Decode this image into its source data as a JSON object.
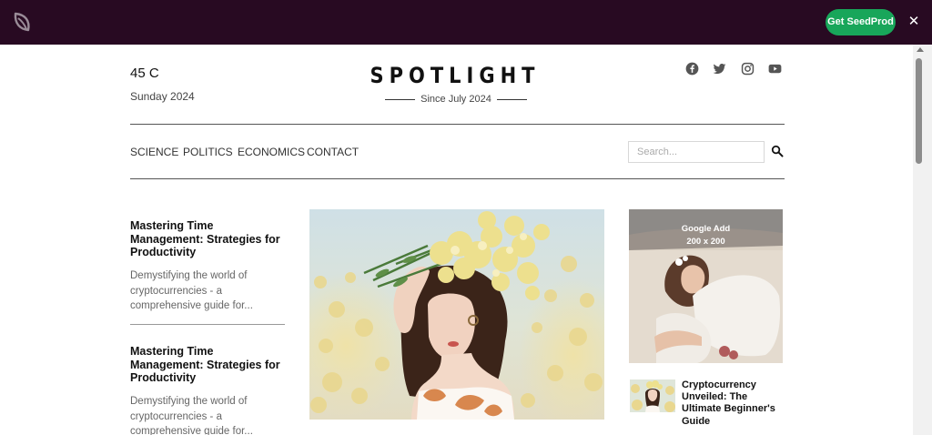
{
  "admin_bar": {
    "logo_icon": "seedprod-leaf-icon",
    "cta_label": "Get SeedProd",
    "close_label": "✕",
    "colors": {
      "background": "#280a22",
      "cta": "#18a65a"
    }
  },
  "header": {
    "temperature": "45 C",
    "date": "Sunday 2024",
    "site_title": "SPOTLIGHT",
    "tagline": "Since July 2024",
    "social_icons": [
      "facebook-icon",
      "twitter-icon",
      "instagram-icon",
      "youtube-icon"
    ]
  },
  "nav": {
    "items": [
      "SCIENCE",
      "POLITICS",
      "ECONOMICS",
      "CONTACT"
    ],
    "search_placeholder": "Search..."
  },
  "articles": [
    {
      "title": "Mastering Time Management: Strategies for Productivity",
      "excerpt": "Demystifying the world of cryptocurrencies - a comprehensive guide for..."
    },
    {
      "title": "Mastering Time Management: Strategies for Productivity",
      "excerpt": "Demystifying the world of cryptocurrencies - a comprehensive guide for..."
    }
  ],
  "ad": {
    "line1": "Google Add",
    "line2": "200 x 200"
  },
  "side_article": {
    "title": "Cryptocurrency Unveiled: The Ultimate Beginner's Guide"
  }
}
